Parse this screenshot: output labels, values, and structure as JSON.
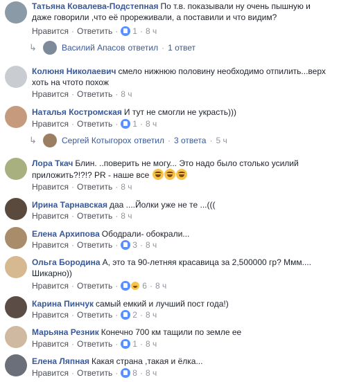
{
  "actions": {
    "like": "Нравится",
    "reply": "Ответить",
    "sep": "·"
  },
  "comments": [
    {
      "author": "Татьяна Ковалева-Подстепная",
      "text": "По т.в. показывали ну очень пышную и даже говорили ,что её прореживали, а поставили и что видим?",
      "likes": "1",
      "time": "8 ч"
    },
    {
      "author": "Колюня Николаевич",
      "text": "смело нижнюю половину необходимо отпилить...верх хоть на чтото похож",
      "likes": "",
      "time": "8 ч"
    },
    {
      "author": "Наталья Костромская",
      "text": "И тут не смогли не украсть)))",
      "likes": "1",
      "time": "8 ч"
    },
    {
      "author": "Лора Ткач",
      "text": "Блин. ..поверить не могу... Это надо было столько усилий приложить?!?!? PR - наше все",
      "likes": "",
      "time": "8 ч"
    },
    {
      "author": "Ирина Тарнавская",
      "text": "даа ....Йолки уже не те ...(((",
      "likes": "",
      "time": "8 ч"
    },
    {
      "author": "Елена Архипова",
      "text": "Ободрали- обокрали...",
      "likes": "3",
      "time": "8 ч"
    },
    {
      "author": "Ольга Бородина",
      "text": "А, это та 90-летняя красавица за 2,500000 гр? Ммм.... Шикарно))",
      "likes": "6",
      "time": "8 ч"
    },
    {
      "author": "Карина Пинчук",
      "text": "самый емкий и лучший пост года!)",
      "likes": "2",
      "time": "8 ч"
    },
    {
      "author": "Марьяна Резник",
      "text": "Конечно 700 км тащили по земле ее",
      "likes": "1",
      "time": "8 ч"
    },
    {
      "author": "Елена Ляпная",
      "text": "Какая страна ,такая и ёлка...",
      "likes": "8",
      "time": "8 ч"
    }
  ],
  "replies": [
    {
      "name": "Василий Апасов",
      "verb": "ответил",
      "count": "1 ответ"
    },
    {
      "name": "Сергей Котыгорох",
      "verb": "ответил",
      "count": "3 ответа",
      "time": "5 ч"
    }
  ],
  "avatar_colors": [
    "#8a9aa6",
    "#c9ccd1",
    "#c69a7c",
    "#a7b07e",
    "#5a4a3e",
    "#a98d6b",
    "#d6b891",
    "#5c4c46",
    "#cfb9a0",
    "#6b6f7a"
  ],
  "reply_avatar_colors": [
    "#7c8a99",
    "#9c7e63"
  ]
}
